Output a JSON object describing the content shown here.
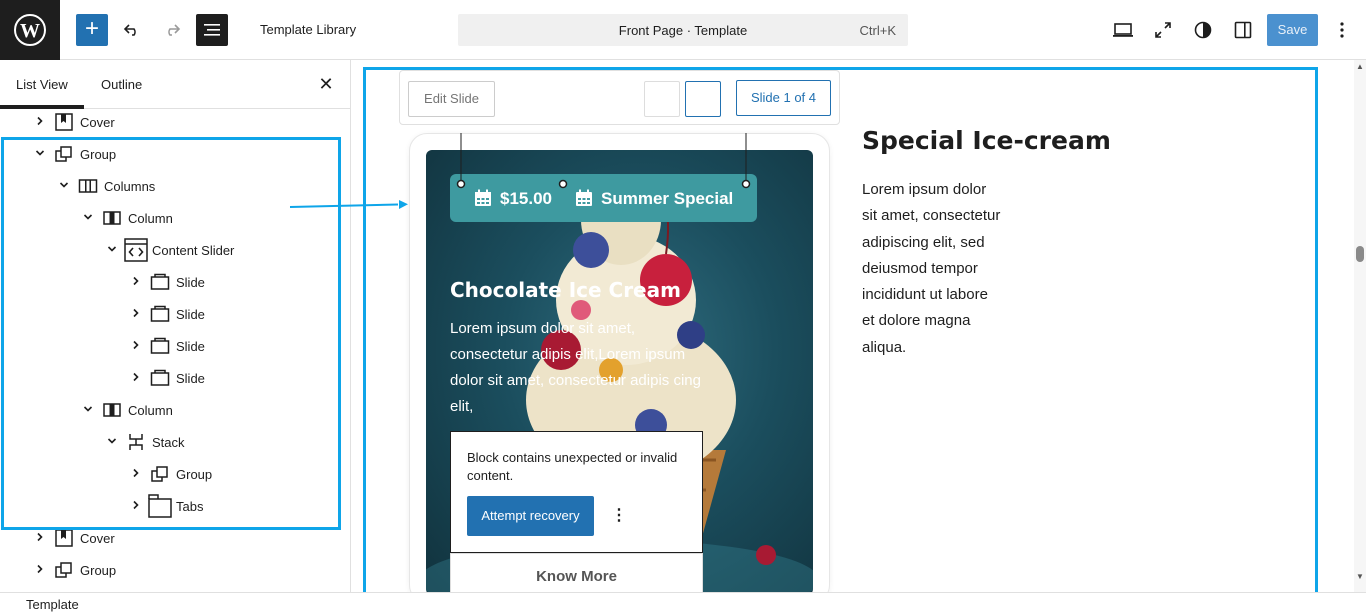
{
  "topbar": {
    "library_label": "Template Library",
    "document_title": "Front Page · Template",
    "shortcut": "Ctrl+K",
    "save_label": "Save",
    "icons": [
      "wordpress-logo-icon",
      "plus-icon",
      "undo-icon",
      "redo-icon",
      "document-overview-icon",
      "desktop-view-icon",
      "fullscreen-icon",
      "styles-contrast-icon",
      "sidebar-settings-icon",
      "more-vertical-icon"
    ]
  },
  "sidebar": {
    "tab_list": "List View",
    "tab_outline": "Outline",
    "tree": [
      {
        "label": "Cover",
        "icon": "cover-icon",
        "chevron": "right"
      },
      {
        "label": "Group",
        "icon": "group-icon",
        "chevron": "down"
      },
      {
        "label": "Columns",
        "icon": "columns-icon",
        "chevron": "down"
      },
      {
        "label": "Column",
        "icon": "column-icon",
        "chevron": "down"
      },
      {
        "label": "Content Slider",
        "icon": "content-slider-icon",
        "chevron": "down"
      },
      {
        "label": "Slide",
        "icon": "slide-icon",
        "chevron": "right"
      },
      {
        "label": "Slide",
        "icon": "slide-icon",
        "chevron": "right"
      },
      {
        "label": "Slide",
        "icon": "slide-icon",
        "chevron": "right"
      },
      {
        "label": "Slide",
        "icon": "slide-icon",
        "chevron": "right"
      },
      {
        "label": "Column",
        "icon": "column-icon",
        "chevron": "down"
      },
      {
        "label": "Stack",
        "icon": "stack-icon",
        "chevron": "down"
      },
      {
        "label": "Group",
        "icon": "group-icon",
        "chevron": "right"
      },
      {
        "label": "Tabs",
        "icon": "tabs-icon",
        "chevron": "right"
      },
      {
        "label": "Cover",
        "icon": "cover-icon",
        "chevron": "right"
      },
      {
        "label": "Group",
        "icon": "group-icon",
        "chevron": "right"
      }
    ]
  },
  "canvas": {
    "edit_slide": "Edit Slide",
    "slide_counter": "Slide 1 of 4",
    "badge_price": "$15.00",
    "badge_event": "Summer Special",
    "card_title": "Chocolate Ice Cream",
    "card_text": "Lorem ipsum dolor sit amet, consectetur adipis elit,Lorem ipsum dolor sit amet, consectetur adipis cing elit,",
    "invalid_message": "Block contains unexpected or invalid content.",
    "recover_label": "Attempt recovery",
    "know_more": "Know More",
    "column_title": "Special Ice-cream",
    "column_text": "Lorem ipsum dolor sit amet, consectetur adipiscing elit, sed deiusmod tempor incididunt ut labore et dolore magna aliqua."
  },
  "status": {
    "breadcrumb": "Template"
  },
  "colors": {
    "accent": "#2271b1",
    "selection": "#0ea5e9",
    "badge": "#3e9aa0"
  }
}
